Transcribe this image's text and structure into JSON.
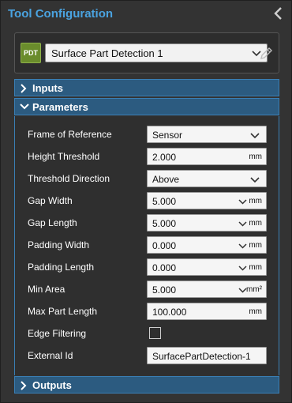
{
  "header": {
    "title": "Tool Configuration"
  },
  "tool": {
    "badge": "PDT",
    "name": "Surface Part Detection 1"
  },
  "sections": {
    "inputs": "Inputs",
    "parameters": "Parameters",
    "outputs": "Outputs"
  },
  "params": [
    {
      "label": "Frame of Reference",
      "value": "Sensor",
      "unit": "",
      "kind": "select"
    },
    {
      "label": "Height Threshold",
      "value": "2.000",
      "unit": "mm",
      "kind": "number"
    },
    {
      "label": "Threshold Direction",
      "value": "Above",
      "unit": "",
      "kind": "select"
    },
    {
      "label": "Gap Width",
      "value": "5.000",
      "unit": "mm",
      "kind": "number-select"
    },
    {
      "label": "Gap Length",
      "value": "5.000",
      "unit": "mm",
      "kind": "number-select"
    },
    {
      "label": "Padding Width",
      "value": "0.000",
      "unit": "mm",
      "kind": "number-select"
    },
    {
      "label": "Padding Length",
      "value": "0.000",
      "unit": "mm",
      "kind": "number-select"
    },
    {
      "label": "Min Area",
      "value": "5.000",
      "unit": "mm²",
      "kind": "number-select"
    },
    {
      "label": "Max Part Length",
      "value": "100.000",
      "unit": "mm",
      "kind": "number"
    },
    {
      "label": "Edge Filtering",
      "value": "",
      "unit": "",
      "kind": "checkbox",
      "checked": false
    },
    {
      "label": "External Id",
      "value": "SurfacePartDetection-1",
      "unit": "",
      "kind": "text"
    }
  ],
  "icons": {
    "collapse": "chevron-left-icon",
    "edit": "pencil-icon",
    "dropdown": "chevron-down-icon",
    "expand": "chevron-right-icon"
  },
  "colors": {
    "accent": "#4aa3e0",
    "section": "#2c5b80",
    "badge": "#6a8c2c"
  }
}
